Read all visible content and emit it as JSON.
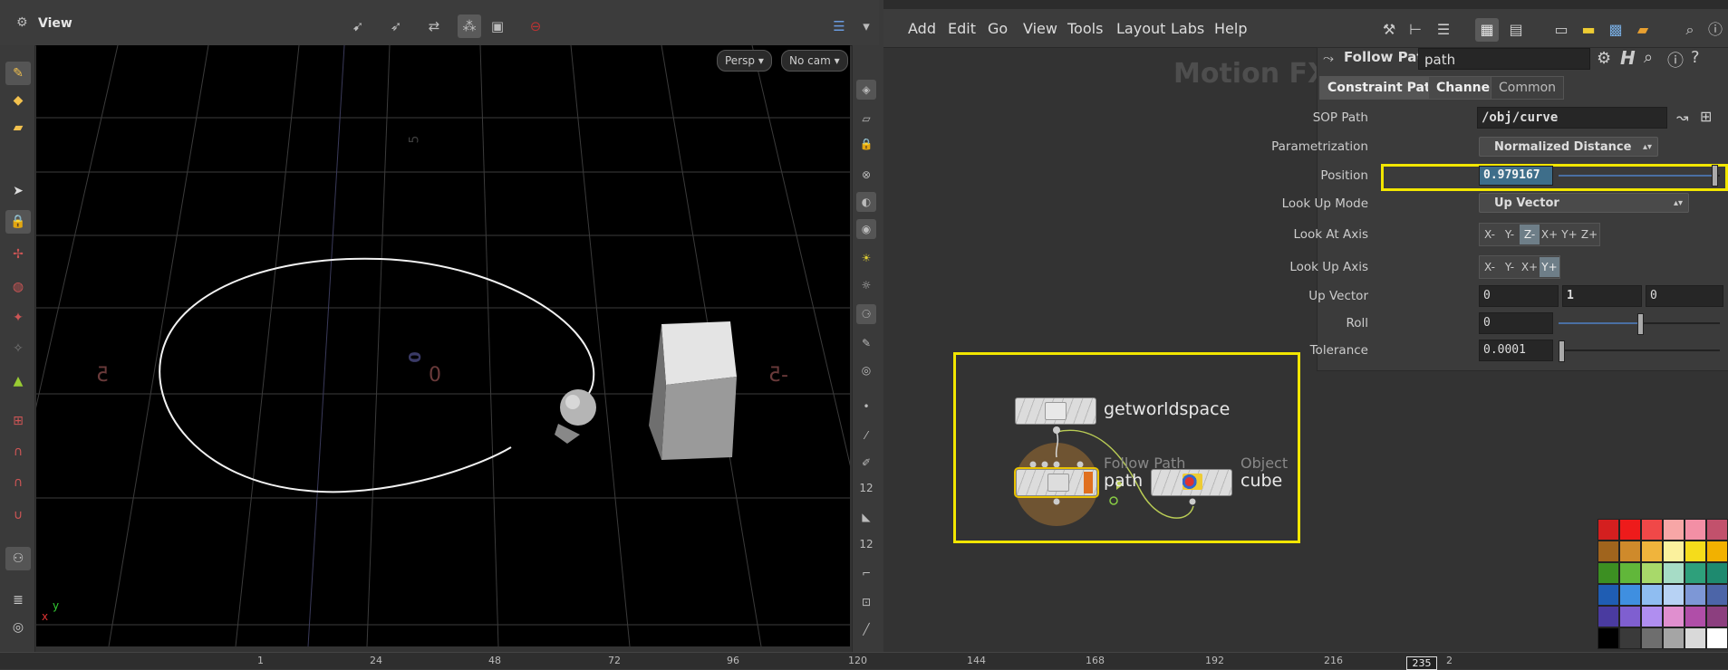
{
  "viewer": {
    "title": "View",
    "persp_label": "Persp",
    "cam_label": "No cam",
    "grid_labels": [
      "5",
      "0",
      "0",
      "5",
      "-5"
    ],
    "axis_x": "x",
    "axis_y": "y"
  },
  "network": {
    "menu": [
      "Add",
      "Edit",
      "Go",
      "View",
      "Tools",
      "Layout",
      "Labs",
      "Help"
    ],
    "watermark": "Motion FX",
    "nodes": [
      {
        "name": "getworldspace",
        "type": ""
      },
      {
        "name": "path",
        "type": "Follow Path"
      },
      {
        "name": "cube",
        "type": "Object"
      }
    ]
  },
  "params": {
    "op_type": "Follow Path",
    "op_name": "path",
    "tabs": [
      "Constraint Path",
      "Channel",
      "Common"
    ],
    "sop_path": {
      "label": "SOP Path",
      "value": "/obj/curve"
    },
    "parametrization": {
      "label": "Parametrization",
      "value": "Normalized Distance"
    },
    "position": {
      "label": "Position",
      "value": "0.979167",
      "fraction": 0.979167
    },
    "lookup_mode": {
      "label": "Look Up Mode",
      "value": "Up Vector"
    },
    "look_at_axis": {
      "label": "Look At Axis",
      "options": [
        "X-",
        "Y-",
        "Z-",
        "X+",
        "Y+",
        "Z+"
      ],
      "selected": "Z-"
    },
    "look_up_axis": {
      "label": "Look Up Axis",
      "options": [
        "X-",
        "Y-",
        "X+",
        "Y+"
      ],
      "selected": "Y+"
    },
    "up_vector": {
      "label": "Up Vector",
      "values": [
        "0",
        "1",
        "0"
      ]
    },
    "roll": {
      "label": "Roll",
      "value": "0",
      "fraction": 0.5
    },
    "tolerance": {
      "label": "Tolerance",
      "value": "0.0001",
      "fraction": 0.0
    }
  },
  "timeline": {
    "ticks": [
      "1",
      "24",
      "48",
      "72",
      "96",
      "120",
      "144",
      "168",
      "192",
      "216"
    ],
    "current_frame": "235",
    "end_partial": "2"
  },
  "palette_colors": [
    [
      "#d41f1f",
      "#ee1b1b",
      "#f04848",
      "#f7a6a6",
      "#f38fa5",
      "#c2516c"
    ],
    [
      "#a0641d",
      "#cf8a2b",
      "#f0b43c",
      "#fbf19d",
      "#f5dc1b",
      "#f2b100"
    ],
    [
      "#3c8f22",
      "#61b73a",
      "#a8d96a",
      "#a6dcc6",
      "#2ea07b",
      "#1e8a6f"
    ],
    [
      "#1f5db3",
      "#3f8fe0",
      "#8fbdf1",
      "#b7d2f4",
      "#7d97d6",
      "#4c65a8"
    ],
    [
      "#4a3ba0",
      "#7f5fd0",
      "#b08ef0",
      "#e08fcf",
      "#b04ea8",
      "#8c3f7f"
    ],
    [
      "#000000",
      "#3a3a3a",
      "#6e6e6e",
      "#a5a5a5",
      "#d9d9d9",
      "#ffffff"
    ]
  ]
}
